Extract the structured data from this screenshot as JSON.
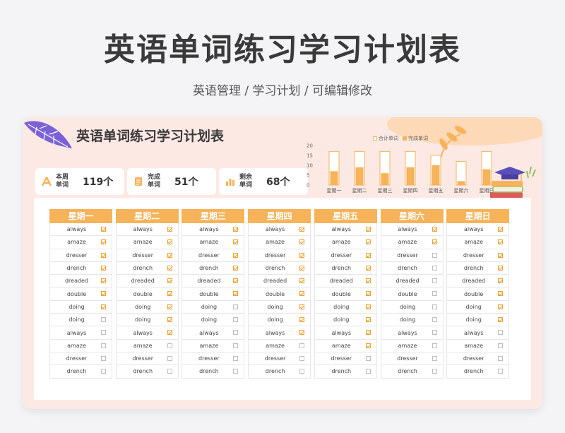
{
  "header": {
    "title": "英语单词练习学习计划表",
    "subtitle": "英语管理 / 学习计划 / 可编辑修改"
  },
  "card": {
    "title": "英语单词练习学习计划表"
  },
  "stats": [
    {
      "label1": "本周",
      "label2": "单词",
      "value": "119个",
      "icon": "a-letter-icon"
    },
    {
      "label1": "完成",
      "label2": "单词",
      "value": "51个",
      "icon": "document-icon"
    },
    {
      "label1": "剩余",
      "label2": "单词",
      "value": "68个",
      "icon": "bar-chart-icon"
    }
  ],
  "chart_data": {
    "type": "bar",
    "categories": [
      "星期一",
      "星期二",
      "星期三",
      "星期四",
      "星期五",
      "星期六",
      "星期日"
    ],
    "series": [
      {
        "name": "合计单词",
        "values": [
          17,
          17,
          17,
          17,
          15,
          12,
          17
        ]
      },
      {
        "name": "完成单词",
        "values": [
          7,
          9,
          6,
          9,
          10,
          2,
          8
        ]
      }
    ],
    "ylim": [
      0,
      20
    ],
    "yticks": [
      "0",
      "5",
      "10",
      "15",
      "20"
    ],
    "colors": {
      "total": "#f6b35a",
      "done": "#f6b35a"
    }
  },
  "days": [
    {
      "name": "星期一",
      "rows": [
        {
          "word": "always",
          "done": true
        },
        {
          "word": "amaze",
          "done": true
        },
        {
          "word": "dresser",
          "done": true
        },
        {
          "word": "drench",
          "done": true
        },
        {
          "word": "dreaded",
          "done": true
        },
        {
          "word": "double",
          "done": true
        },
        {
          "word": "doing",
          "done": true
        },
        {
          "word": "doing",
          "done": false
        },
        {
          "word": "always",
          "done": false
        },
        {
          "word": "amaze",
          "done": false
        },
        {
          "word": "dresser",
          "done": false
        },
        {
          "word": "drench",
          "done": false
        }
      ]
    },
    {
      "name": "星期二",
      "rows": [
        {
          "word": "always",
          "done": true
        },
        {
          "word": "amaze",
          "done": true
        },
        {
          "word": "dresser",
          "done": true
        },
        {
          "word": "drench",
          "done": true
        },
        {
          "word": "dreaded",
          "done": true
        },
        {
          "word": "double",
          "done": true
        },
        {
          "word": "doing",
          "done": true
        },
        {
          "word": "doing",
          "done": true
        },
        {
          "word": "always",
          "done": true
        },
        {
          "word": "amaze",
          "done": false
        },
        {
          "word": "dresser",
          "done": false
        },
        {
          "word": "drench",
          "done": false
        }
      ]
    },
    {
      "name": "星期三",
      "rows": [
        {
          "word": "always",
          "done": true
        },
        {
          "word": "amaze",
          "done": true
        },
        {
          "word": "dresser",
          "done": true
        },
        {
          "word": "drench",
          "done": true
        },
        {
          "word": "dreaded",
          "done": true
        },
        {
          "word": "double",
          "done": true
        },
        {
          "word": "doing",
          "done": false
        },
        {
          "word": "doing",
          "done": false
        },
        {
          "word": "always",
          "done": false
        },
        {
          "word": "amaze",
          "done": false
        },
        {
          "word": "dresser",
          "done": false
        },
        {
          "word": "drench",
          "done": false
        }
      ]
    },
    {
      "name": "星期四",
      "rows": [
        {
          "word": "always",
          "done": true
        },
        {
          "word": "amaze",
          "done": true
        },
        {
          "word": "dresser",
          "done": true
        },
        {
          "word": "drench",
          "done": true
        },
        {
          "word": "dreaded",
          "done": true
        },
        {
          "word": "double",
          "done": true
        },
        {
          "word": "doing",
          "done": true
        },
        {
          "word": "doing",
          "done": true
        },
        {
          "word": "always",
          "done": true
        },
        {
          "word": "amaze",
          "done": false
        },
        {
          "word": "dresser",
          "done": false
        },
        {
          "word": "drench",
          "done": false
        }
      ]
    },
    {
      "name": "星期五",
      "rows": [
        {
          "word": "always",
          "done": true
        },
        {
          "word": "amaze",
          "done": true
        },
        {
          "word": "dresser",
          "done": true
        },
        {
          "word": "drench",
          "done": true
        },
        {
          "word": "dreaded",
          "done": true
        },
        {
          "word": "double",
          "done": true
        },
        {
          "word": "doing",
          "done": true
        },
        {
          "word": "doing",
          "done": true
        },
        {
          "word": "always",
          "done": true
        },
        {
          "word": "amaze",
          "done": true
        },
        {
          "word": "dresser",
          "done": false
        },
        {
          "word": "drench",
          "done": false
        }
      ]
    },
    {
      "name": "星期六",
      "rows": [
        {
          "word": "always",
          "done": true
        },
        {
          "word": "amaze",
          "done": true
        },
        {
          "word": "dresser",
          "done": false
        },
        {
          "word": "drench",
          "done": false
        },
        {
          "word": "dreaded",
          "done": false
        },
        {
          "word": "double",
          "done": false
        },
        {
          "word": "doing",
          "done": false
        },
        {
          "word": "doing",
          "done": false
        },
        {
          "word": "always",
          "done": false
        },
        {
          "word": "amaze",
          "done": false
        },
        {
          "word": "dresser",
          "done": false
        },
        {
          "word": "drench",
          "done": false
        }
      ]
    },
    {
      "name": "星期日",
      "rows": [
        {
          "word": "always",
          "done": true
        },
        {
          "word": "amaze",
          "done": true
        },
        {
          "word": "dresser",
          "done": true
        },
        {
          "word": "drench",
          "done": true
        },
        {
          "word": "dreaded",
          "done": true
        },
        {
          "word": "double",
          "done": true
        },
        {
          "word": "doing",
          "done": true
        },
        {
          "word": "doing",
          "done": true
        },
        {
          "word": "always",
          "done": false
        },
        {
          "word": "amaze",
          "done": false
        },
        {
          "word": "dresser",
          "done": false
        },
        {
          "word": "drench",
          "done": false
        }
      ]
    }
  ]
}
